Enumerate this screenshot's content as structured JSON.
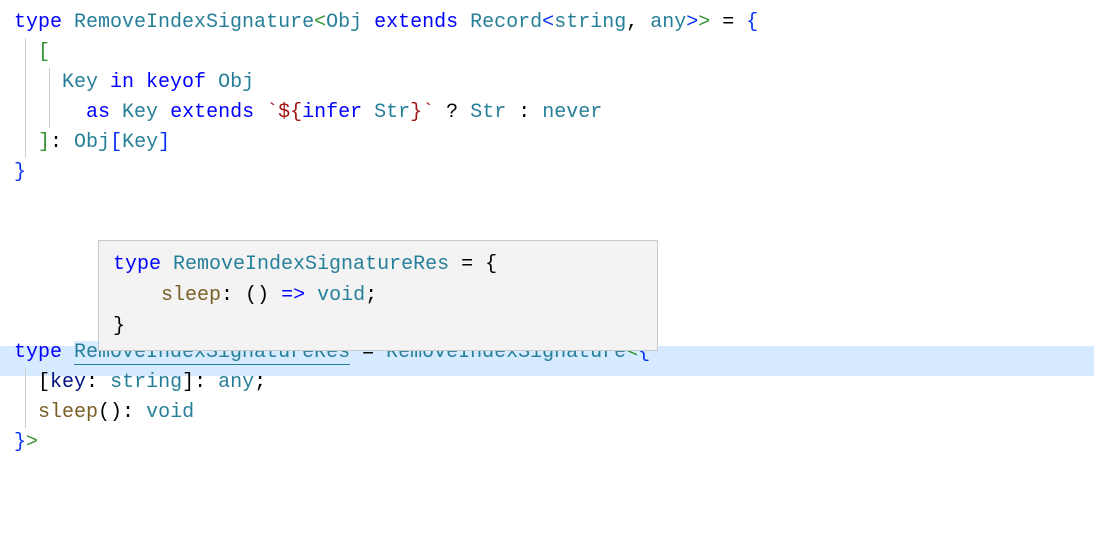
{
  "code": {
    "line1": {
      "kw_type": "type",
      "type_name": "RemoveIndexSignature",
      "lt": "<",
      "generic": "Obj",
      "kw_extends": "extends",
      "record": "Record",
      "lt2": "<",
      "string_kw": "string",
      "comma": ", ",
      "any_kw": "any",
      "gt2": ">",
      "gt": ">",
      "eq": " = ",
      "brace": "{"
    },
    "line2": {
      "indent": "  ",
      "bracket": "["
    },
    "line3": {
      "indent": "    ",
      "key": "Key",
      "in_kw": " in ",
      "keyof_kw": "keyof",
      "space": " ",
      "obj": "Obj"
    },
    "line4": {
      "indent": "      ",
      "as_kw": "as",
      "space": " ",
      "key": "Key",
      "extends_kw": " extends ",
      "tmpl_open": "`${",
      "infer_kw": "infer",
      "space2": " ",
      "str": "Str",
      "tmpl_close": "}`",
      "question": " ? ",
      "str2": "Str",
      "colon": " : ",
      "never_kw": "never"
    },
    "line5": {
      "indent": "  ",
      "bracket": "]",
      "colon": ": ",
      "obj": "Obj",
      "lbracket": "[",
      "key": "Key",
      "rbracket": "]"
    },
    "line6": {
      "brace": "}"
    },
    "line7": {
      "empty": ""
    },
    "line8": {
      "kw_type": "type",
      "space": " ",
      "type_name": "RemoveIndexSignatureRes",
      "eq": " = ",
      "ref_type": "RemoveIndexSignature",
      "lt": "<",
      "brace": "{"
    },
    "line9": {
      "indent": "  ",
      "lbracket": "[",
      "key_label": "key",
      "colon": ": ",
      "string_kw": "string",
      "rbracket": "]",
      "colon2": ": ",
      "any_kw": "any",
      "semi": ";"
    },
    "line10": {
      "indent": "  ",
      "sleep": "sleep",
      "parens": "()",
      "colon": ": ",
      "void_kw": "void"
    },
    "line11": {
      "brace": "}",
      "gt": ">"
    }
  },
  "tooltip": {
    "line1": {
      "kw_type": "type",
      "space": " ",
      "type_name": "RemoveIndexSignatureRes",
      "eq": " = ",
      "brace": "{"
    },
    "line2": {
      "indent": "    ",
      "sleep": "sleep",
      "colon": ": ",
      "lparen": "(",
      "rparen": ")",
      "arrow": " => ",
      "void_kw": "void",
      "semi": ";"
    },
    "line3": {
      "brace": "}"
    }
  }
}
